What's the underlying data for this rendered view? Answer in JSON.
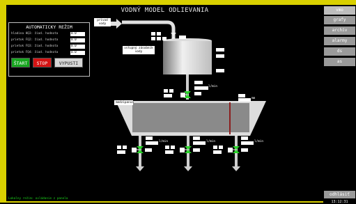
{
  "title": "VODNÝ MODEL ODLIEVANIA",
  "auto_mode": {
    "title": "AUTOMATICKY REŽIM",
    "rows": [
      {
        "label": "hladina HQ3: žiad. hodnota",
        "value": "0.0"
      },
      {
        "label": "prietok FQ2: žiad. hodnota",
        "value": "0.0"
      },
      {
        "label": "prietok FQ3: žiad. hodnota",
        "value": "0.0"
      },
      {
        "label": "prietok FQ4: žiad. hodnota",
        "value": "0.0"
      }
    ],
    "start_label": "ŠTART",
    "stop_label": "STOP",
    "release_label": "VYPUSTI"
  },
  "labels": {
    "water_inlet": "prívod vody",
    "input_tank": "vstupný zásobník vody",
    "tundish": "medzipanva"
  },
  "sidebar": {
    "items": [
      "vmo",
      "grafy",
      "archív",
      "alarmy",
      "ds",
      "as"
    ],
    "active_index": 0,
    "logout": "odhlásiť",
    "clock": "13:12:31"
  },
  "status_message": "Lokalny režim: ovládanie z panela",
  "unit_flow": "l/min",
  "unit_level": "mm",
  "colors": {
    "frame": "#d9d000",
    "start": "#17a61f",
    "stop": "#d41313",
    "valve": "#2bd42b"
  }
}
